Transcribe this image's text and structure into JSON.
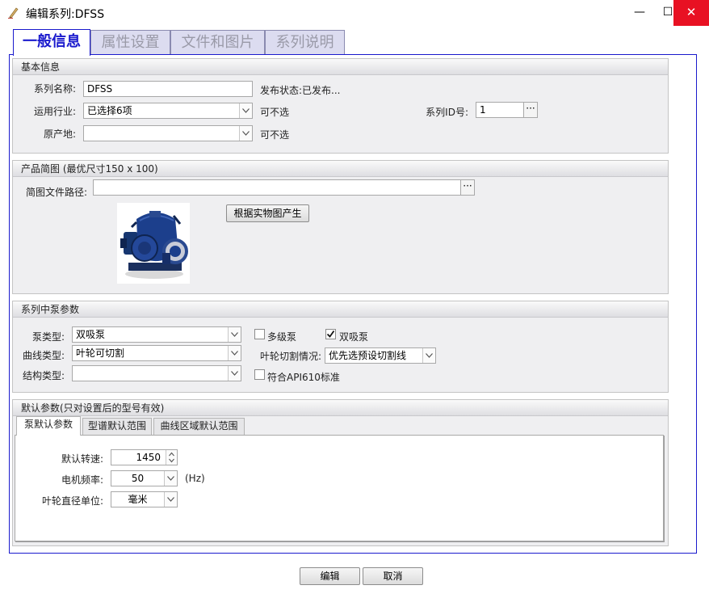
{
  "window": {
    "title": "编辑系列:DFSS",
    "minimize_glyph": "—",
    "maximize_glyph": "☐",
    "close_glyph": "✕"
  },
  "main_tabs": [
    {
      "label": "一般信息",
      "active": true
    },
    {
      "label": "属性设置",
      "active": false
    },
    {
      "label": "文件和图片",
      "active": false
    },
    {
      "label": "系列说明",
      "active": false
    }
  ],
  "basic_info": {
    "header": "基本信息",
    "series_name_label": "系列名称:",
    "series_name_value": "DFSS",
    "publish_status": "发布状态:已发布...",
    "industry_label": "运用行业:",
    "industry_value": "已选择6项",
    "industry_hint": "可不选",
    "series_id_label": "系列ID号:",
    "series_id_value": "1",
    "origin_label": "原产地:",
    "origin_value": "",
    "origin_hint": "可不选",
    "ellipsis": "···"
  },
  "product_sketch": {
    "header": "产品简图 (最优尺寸150 x 100)",
    "path_label": "简图文件路径:",
    "path_value": "",
    "ellipsis": "···",
    "generate_button": "根据实物图产生"
  },
  "pump_params": {
    "header": "系列中泵参数",
    "pump_type_label": "泵类型:",
    "pump_type_value": "双吸泵",
    "multistage_label": "多级泵",
    "multistage_checked": false,
    "double_suction_label": "双吸泵",
    "double_suction_checked": true,
    "curve_type_label": "曲线类型:",
    "curve_type_value": "叶轮可切割",
    "impeller_cut_label": "叶轮切割情况:",
    "impeller_cut_value": "优先选预设切割线",
    "structure_type_label": "结构类型:",
    "structure_type_value": "",
    "api610_label": "符合API610标准",
    "api610_checked": false
  },
  "default_params": {
    "header": "默认参数(只对设置后的型号有效)",
    "tabs": [
      {
        "label": "泵默认参数",
        "active": true
      },
      {
        "label": "型谱默认范围",
        "active": false
      },
      {
        "label": "曲线区域默认范围",
        "active": false
      }
    ],
    "speed_label": "默认转速:",
    "speed_value": "1450",
    "frequency_label": "电机频率:",
    "frequency_value": "50",
    "frequency_unit": "(Hz)",
    "impeller_unit_label": "叶轮直径单位:",
    "impeller_unit_value": "毫米"
  },
  "footer": {
    "edit_button": "编辑",
    "cancel_button": "取消"
  },
  "colors": {
    "accent": "#1a1acd",
    "close_red": "#e81123",
    "pump_blue": "#1c3f8c"
  }
}
